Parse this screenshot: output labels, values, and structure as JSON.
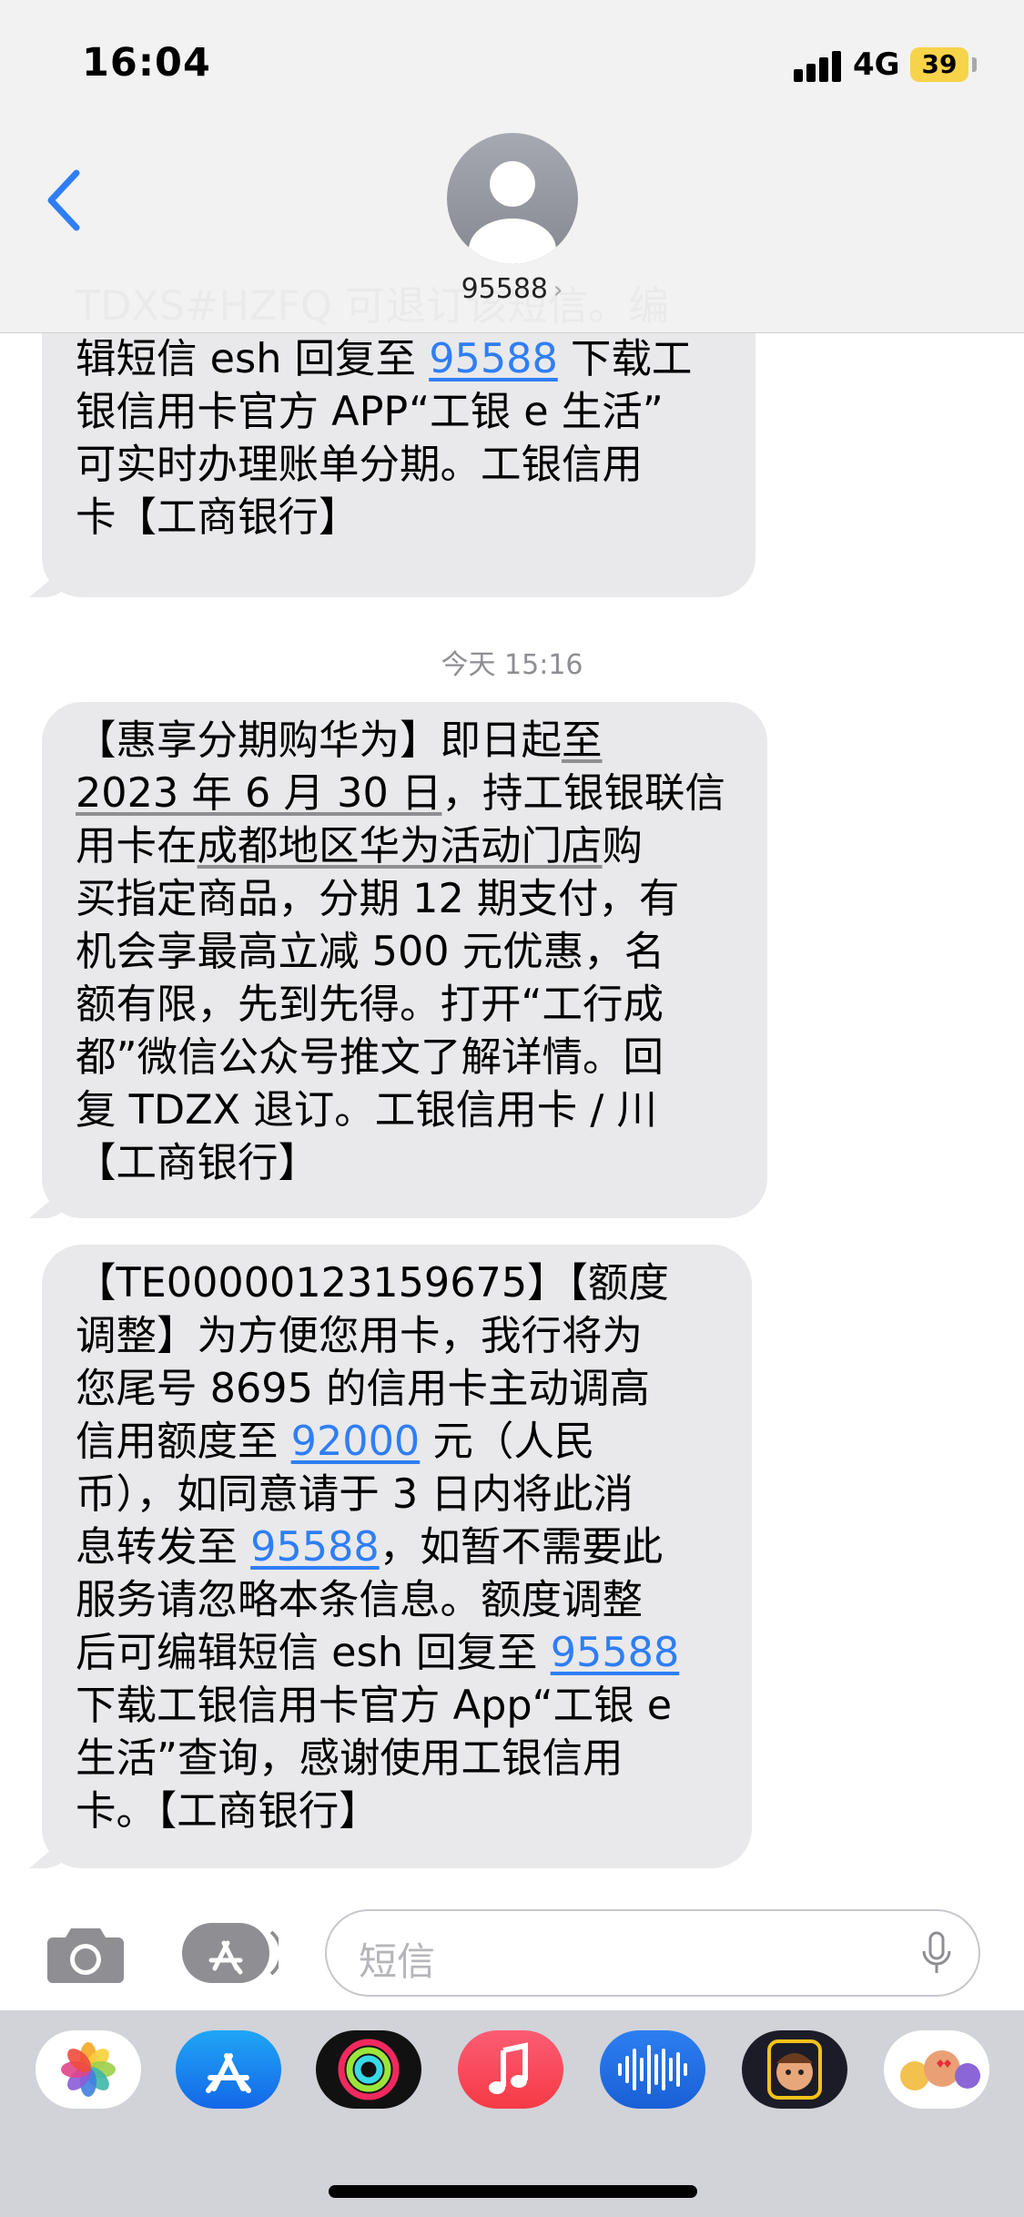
{
  "status_bar": {
    "time": "16:04",
    "network": "4G",
    "battery": "39"
  },
  "header": {
    "contact": "95588"
  },
  "messages": [
    {
      "lines": [
        [
          {
            "t": "TDXS#HZFQ 可退订该短信。编"
          }
        ],
        [
          {
            "t": "辑短信 esh 回复至 "
          },
          {
            "t": "95588",
            "link": true
          },
          {
            "t": " 下载工"
          }
        ],
        [
          {
            "t": "银信用卡官方 APP“工银 e 生活”"
          }
        ],
        [
          {
            "t": "可实时办理账单分期。工银信用"
          }
        ],
        [
          {
            "t": "卡【工商银行】"
          }
        ]
      ]
    },
    {
      "lines": [
        [
          {
            "t": "【惠享分期购华为】即日起"
          },
          {
            "t": "至",
            "ul": true
          }
        ],
        [
          {
            "t": "2023 年 6 月 30 日",
            "ul": true
          },
          {
            "t": "，持工银银联信"
          }
        ],
        [
          {
            "t": "用卡在"
          },
          {
            "t": "成都地区华为活动门店",
            "ul": true
          },
          {
            "t": "购"
          }
        ],
        [
          {
            "t": "买指定商品，分期 12 期支付，有"
          }
        ],
        [
          {
            "t": "机会享最高立减 500 元优惠，名"
          }
        ],
        [
          {
            "t": "额有限，先到先得。打开“工行成"
          }
        ],
        [
          {
            "t": "都”微信公众号推文了解详情。回"
          }
        ],
        [
          {
            "t": "复 TDZX 退订。工银信用卡 / 川"
          }
        ],
        [
          {
            "t": "【工商银行】"
          }
        ]
      ]
    },
    {
      "lines": [
        [
          {
            "t": "【TE00000123159675】【额度"
          }
        ],
        [
          {
            "t": "调整】为方便您用卡，我行将为"
          }
        ],
        [
          {
            "t": "您尾号 8695 的信用卡主动调高"
          }
        ],
        [
          {
            "t": "信用额度至 "
          },
          {
            "t": "92000",
            "link": true
          },
          {
            "t": " 元（人民"
          }
        ],
        [
          {
            "t": "币），如同意请于 3 日内将此消"
          }
        ],
        [
          {
            "t": "息转发至 "
          },
          {
            "t": "95588",
            "link": true
          },
          {
            "t": "，如暂不需要此"
          }
        ],
        [
          {
            "t": "服务请忽略本条信息。额度调整"
          }
        ],
        [
          {
            "t": "后可编辑短信 esh 回复至 "
          },
          {
            "t": "95588",
            "link": true
          }
        ],
        [
          {
            "t": "下载工银信用卡官方 App“工银 e"
          }
        ],
        [
          {
            "t": "生活”查询，感谢使用工银信用"
          }
        ],
        [
          {
            "t": "卡。【工商银行】"
          }
        ]
      ]
    }
  ],
  "timestamp": "今天 15:16",
  "input": {
    "placeholder": "短信"
  },
  "colors": {
    "link": "#2f7ef6",
    "bubble": "#e9e9eb",
    "battery": "#f7d34a"
  },
  "icons": [
    "back-icon",
    "avatar-icon",
    "chevron-right-icon",
    "camera-icon",
    "app-store-icon",
    "microphone-icon"
  ],
  "apps": [
    "photos-app-icon",
    "app-store-app-icon",
    "fitness-app-icon",
    "music-app-icon",
    "voice-memos-app-icon",
    "memoji-app-icon",
    "memoji-stickers-app-icon"
  ]
}
